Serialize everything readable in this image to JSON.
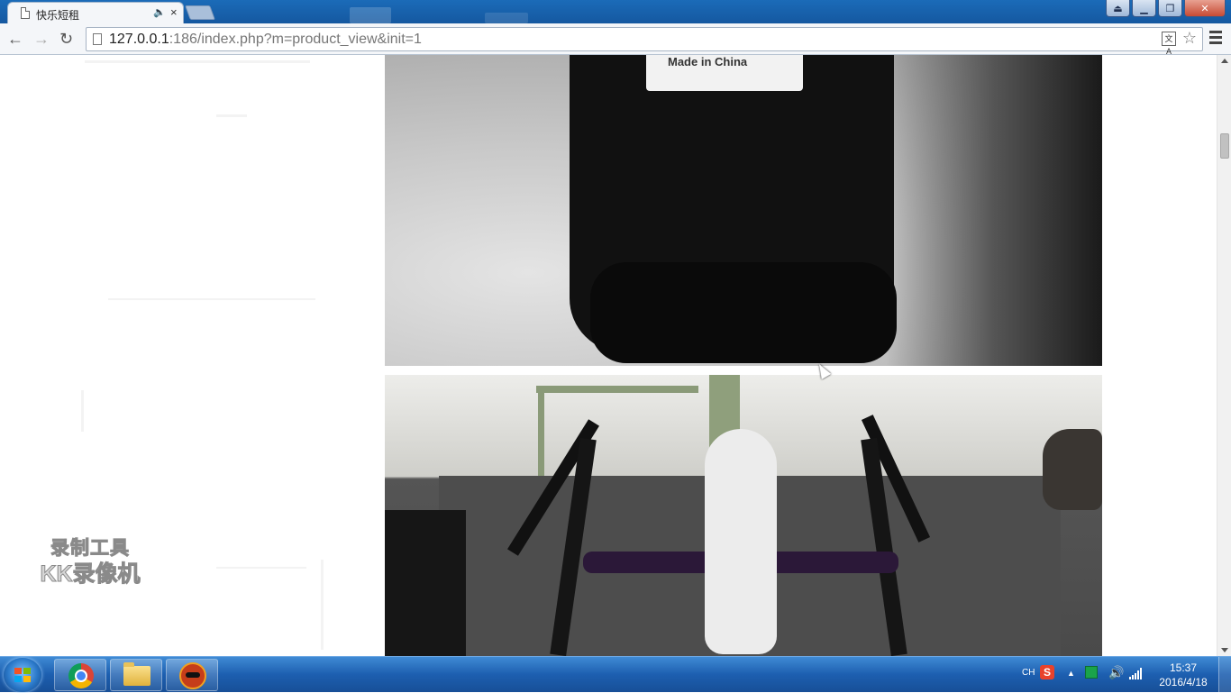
{
  "browser": {
    "tab_title": "快乐短租",
    "tab_audio_icon": "speaker-icon",
    "tab_close": "×",
    "url_host": "127.0.0.1",
    "url_rest": ":186/index.php?m=product_view&init=1",
    "window_controls": [
      "minimize",
      "restore",
      "close"
    ]
  },
  "page": {
    "photo1_label": "Made in China",
    "watermark_line1": "录制工具",
    "watermark_line2": "KK录像机"
  },
  "taskbar": {
    "apps": [
      "chrome",
      "file-explorer",
      "kk-recorder"
    ],
    "tray": {
      "language": "CH",
      "ime": "S"
    },
    "clock_time": "15:37",
    "clock_date": "2016/4/18"
  }
}
